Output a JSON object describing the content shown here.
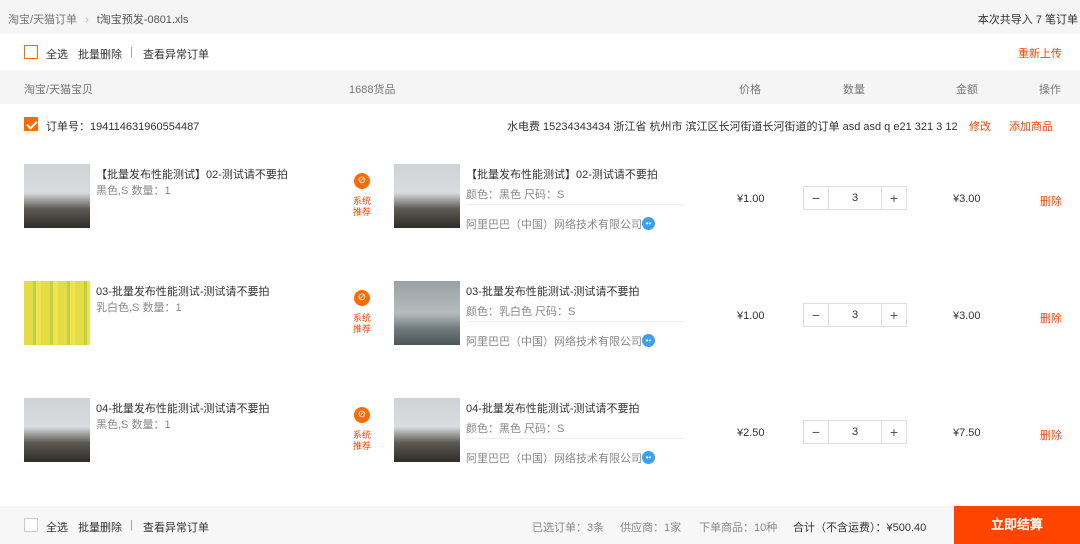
{
  "breadcrumb": {
    "root": "淘宝/天猫订单",
    "file": "t淘宝预发-0801.xls"
  },
  "import_summary": "本次共导入 7 笔订单",
  "actions": {
    "select_all": "全选",
    "batch_delete": "批量删除",
    "divider": "|",
    "view_abnormal": "查看异常订单",
    "reupload": "重新上传"
  },
  "table_headers": {
    "taobao_item": "淘宝/天猫宝贝",
    "goods_1688": "1688货品",
    "price": "价格",
    "quantity": "数量",
    "amount": "金额",
    "operation": "操作"
  },
  "order": {
    "number_label": "订单号：194114631960554487",
    "address": "水电费 15234343434 浙江省 杭州市 滨江区长河街道长河街道的订单 asd asd q e21 321 3 12",
    "edit": "修改",
    "add_item": "添加商品"
  },
  "items": [
    {
      "tb_title": "【批量发布性能测试】02-测试请不要拍",
      "tb_spec": "黑色,S 数量：1",
      "sys_tag_line1": "系统",
      "sys_tag_line2": "推荐",
      "goods_title": "【批量发布性能测试】02-测试请不要拍",
      "goods_spec": "颜色：黑色 尺码：S",
      "supplier": "阿里巴巴（中国）网络技术有限公司",
      "price": "¥1.00",
      "qty": "3",
      "amount": "¥3.00",
      "delete": "删除"
    },
    {
      "tb_title": "03-批量发布性能测试-测试请不要拍",
      "tb_spec": "乳白色,S 数量：1",
      "sys_tag_line1": "系统",
      "sys_tag_line2": "推荐",
      "goods_title": "03-批量发布性能测试-测试请不要拍",
      "goods_spec": "颜色：乳白色 尺码：S",
      "supplier": "阿里巴巴（中国）网络技术有限公司",
      "price": "¥1.00",
      "qty": "3",
      "amount": "¥3.00",
      "delete": "删除"
    },
    {
      "tb_title": "04-批量发布性能测试-测试请不要拍",
      "tb_spec": "黑色,S 数量：1",
      "sys_tag_line1": "系统",
      "sys_tag_line2": "推荐",
      "goods_title": "04-批量发布性能测试-测试请不要拍",
      "goods_spec": "颜色：黑色 尺码：S",
      "supplier": "阿里巴巴（中国）网络技术有限公司",
      "price": "¥2.50",
      "qty": "3",
      "amount": "¥7.50",
      "delete": "删除"
    }
  ],
  "footer": {
    "select_all": "全选",
    "batch_delete": "批量删除",
    "divider": "|",
    "view_abnormal": "查看异常订单",
    "selected_orders": "已选订单：3条",
    "suppliers": "供应商：1家",
    "items_count": "下单商品：10种",
    "total": "合计（不含运费）：¥500.40",
    "checkout": "立即结算"
  },
  "icons": {
    "minus": "−",
    "plus": "+",
    "link": "⊘",
    "wangwang": "••"
  },
  "colors": {
    "accent": "#ff4400",
    "checkbox": "#ff6a00",
    "wangwang": "#3aa0ef"
  }
}
